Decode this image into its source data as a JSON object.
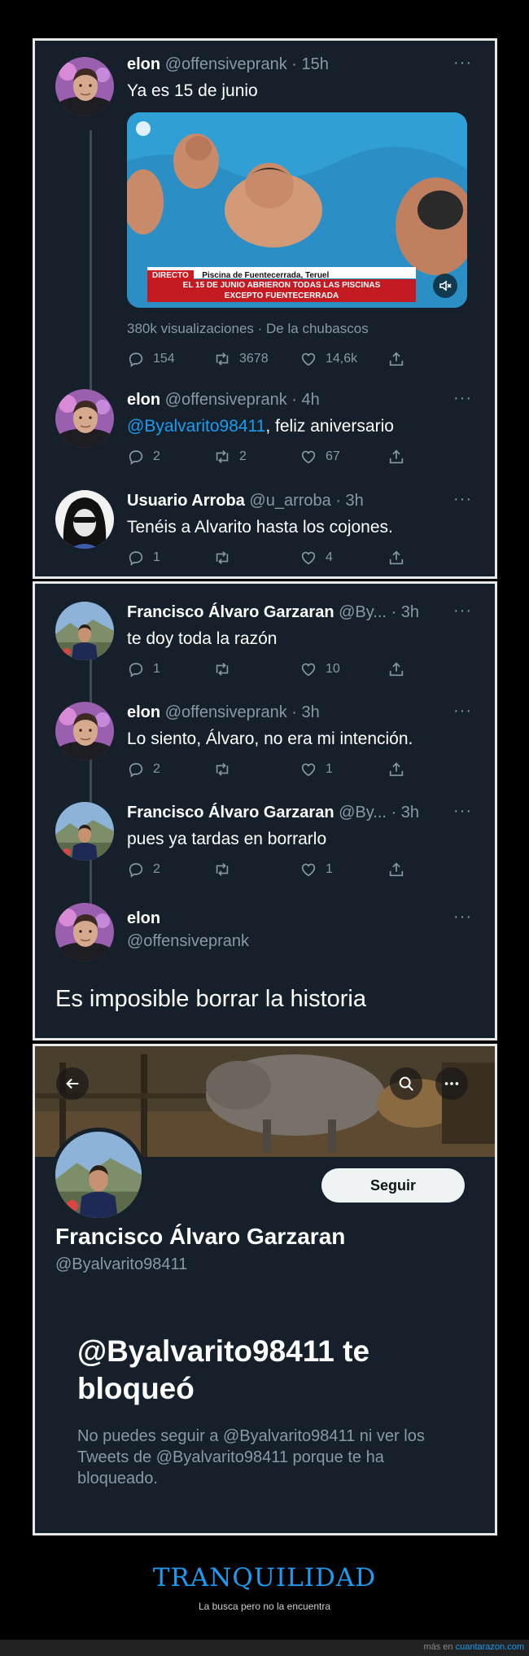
{
  "panel1": {
    "tweets": [
      {
        "name": "elon",
        "handle": "@offensiveprank · 15h",
        "text": "Ya es 15 de junio",
        "media": {
          "badge": "DIRECTO",
          "location": "Piscina de Fuentecerrada, Teruel",
          "caption_line1": "EL 15 DE JUNIO ABRIERON TODAS LAS PISCINAS",
          "caption_line2": "EXCEPTO FUENTECERRADA"
        },
        "views": "380k visualizaciones · De la chubascos",
        "replies": "154",
        "retweets": "3678",
        "likes": "14,6k"
      },
      {
        "name": "elon",
        "handle": "@offensiveprank · 4h",
        "mention": "@Byalvarito98411",
        "text_rest": ", feliz aniversario",
        "replies": "2",
        "retweets": "2",
        "likes": "67"
      },
      {
        "name": "Usuario Arroba",
        "handle": "@u_arroba · 3h",
        "text": "Tenéis a Alvarito hasta los cojones.",
        "replies": "1",
        "retweets": "",
        "likes": "4"
      }
    ]
  },
  "panel2": {
    "tweets": [
      {
        "name": "Francisco Álvaro Garzaran",
        "handle": "@By... · 3h",
        "text": "te doy toda la razón",
        "replies": "1",
        "retweets": "",
        "likes": "10"
      },
      {
        "name": "elon",
        "handle": "@offensiveprank · 3h",
        "text": "Lo siento, Álvaro, no era mi intención.",
        "replies": "2",
        "retweets": "",
        "likes": "1"
      },
      {
        "name": "Francisco Álvaro Garzaran",
        "handle": "@By... · 3h",
        "text": "pues ya tardas en borrarlo",
        "replies": "2",
        "retweets": "",
        "likes": "1"
      }
    ],
    "big_tweet": {
      "name": "elon",
      "handle": "@offensiveprank",
      "text": "Es imposible borrar la historia"
    }
  },
  "profile": {
    "follow_label": "Seguir",
    "name": "Francisco Álvaro Garzaran",
    "handle": "@Byalvarito98411",
    "block_title": "@Byalvarito98411 te bloqueó",
    "block_desc": "No puedes seguir a @Byalvarito98411 ni ver los Tweets de @Byalvarito98411 porque te ha bloqueado."
  },
  "more_glyph": "···",
  "footer": {
    "title": "TRANQUILIDAD",
    "subtitle": "La busca pero no la encuentra",
    "credit_prefix": "más en",
    "credit_site": "cuantarazon.com"
  },
  "colors": {
    "background": "#15202b",
    "accent": "#1d9bf0",
    "muted": "#8899a6"
  }
}
